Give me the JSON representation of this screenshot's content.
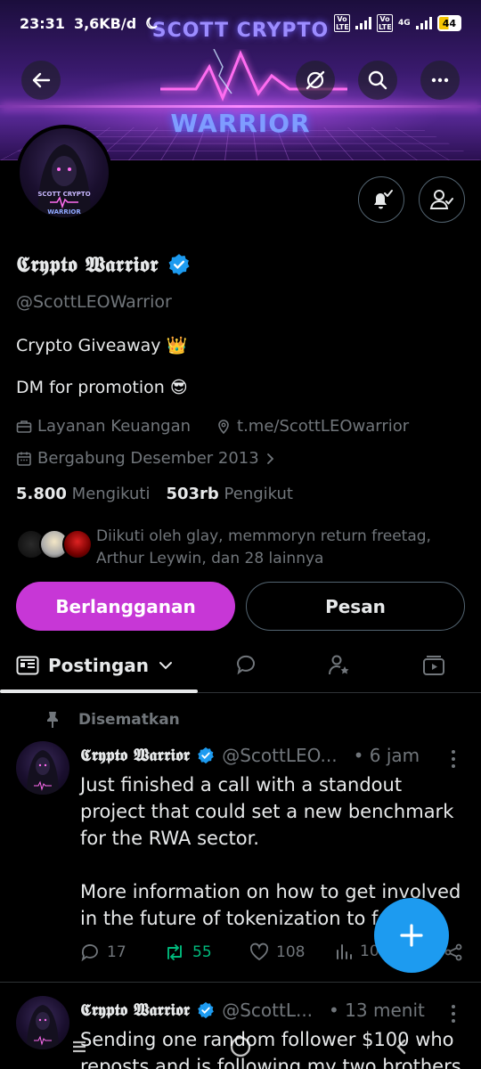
{
  "status_bar": {
    "time": "23:31",
    "speed": "3,6KB/d",
    "network1": "Vo LTE",
    "network2": "Vo LTE",
    "network_type": "4G",
    "battery": "44"
  },
  "banner": {
    "title_top": "SCOTT CRYPTO",
    "title_bottom": "WARRIOR"
  },
  "avatar_text": {
    "line1": "SCOTT CRYPTO",
    "line2": "WARRIOR"
  },
  "profile": {
    "name": "𝕮𝖗𝖞𝖕𝖙𝖔 𝖂𝖆𝖗𝖗𝖎𝖔𝖗",
    "handle": "@ScottLEOWarrior",
    "bio_line1": "Crypto Giveaway 👑",
    "bio_line2": "DM for promotion 😎",
    "category": "Layanan Keuangan",
    "link": "t.me/ScottLEOwarrior",
    "joined": "Bergabung Desember 2013",
    "following_count": "5.800",
    "following_label": "Mengikuti",
    "followers_count": "503rb",
    "followers_label": "Pengikut",
    "followed_by": "Diikuti oleh glay, memmoryn return freetag, Arthur Leywin, dan 28 lainnya"
  },
  "buttons": {
    "subscribe": "Berlangganan",
    "message": "Pesan"
  },
  "tabs": {
    "active": "Postingan"
  },
  "posts": [
    {
      "pinned_label": "Disematkan",
      "name": "𝕮𝖗𝖞𝖕𝖙𝖔 𝖂𝖆𝖗𝖗𝖎𝖔𝖗",
      "handle": "@ScottLEO...",
      "time": "• 6 jam",
      "body_p1": "Just finished a call with a standout project that could set a new benchmark for the RWA sector.",
      "body_p2": "More information on how to get involved in the future of tokenization to fo",
      "replies": "17",
      "reposts": "55",
      "likes": "108",
      "views": "10"
    },
    {
      "name": "𝕮𝖗𝖞𝖕𝖙𝖔 𝖂𝖆𝖗𝖗𝖎𝖔𝖗",
      "handle": "@ScottL...",
      "time": "• 13 menit",
      "body": "Sending one random follower $100 who reposts and is following my two brothers"
    }
  ],
  "colors": {
    "accent_blue": "#1d9bf0",
    "subscribe_purple": "#c737d6",
    "repost_green": "#00ba7c",
    "muted": "#71767b"
  }
}
